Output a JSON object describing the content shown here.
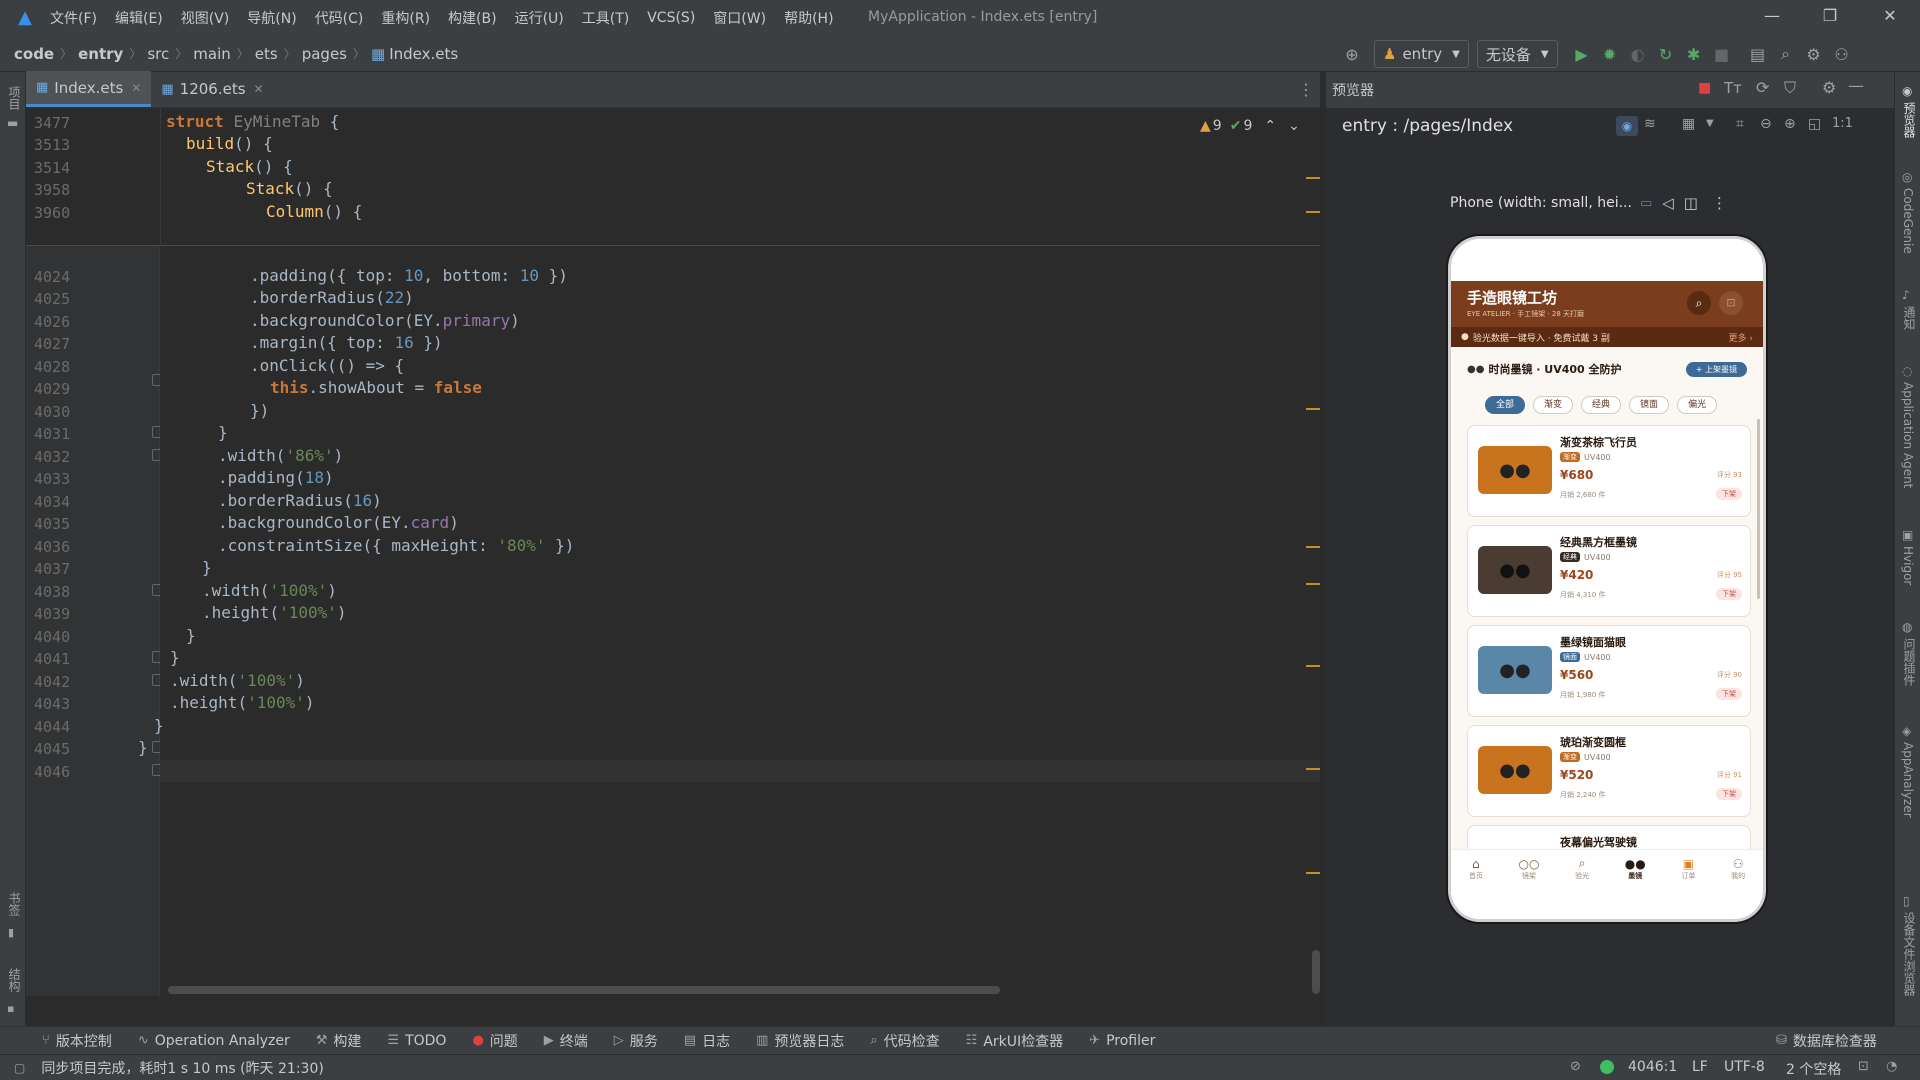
{
  "menubar": {
    "items": [
      "文件(F)",
      "编辑(E)",
      "视图(V)",
      "导航(N)",
      "代码(C)",
      "重构(R)",
      "构建(B)",
      "运行(U)",
      "工具(T)",
      "VCS(S)",
      "窗口(W)",
      "帮助(H)"
    ],
    "title": "MyApplication - Index.ets [entry]"
  },
  "breadcrumb": [
    "code",
    "entry",
    "src",
    "main",
    "ets",
    "pages",
    "Index.ets"
  ],
  "toolbar": {
    "module": "entry",
    "device": "无设备"
  },
  "left_strip": {
    "top": "项目",
    "mid": "书签",
    "bottom": "结构"
  },
  "tabs": [
    "Index.ets",
    "1206.ets"
  ],
  "inspect": {
    "warnings": "9",
    "checks": "9"
  },
  "sticky": [
    {
      "n": "3477"
    },
    {
      "n": "3513"
    },
    {
      "n": "3514"
    },
    {
      "n": "3958"
    },
    {
      "n": "3960"
    }
  ],
  "lines": [
    "4024",
    "4025",
    "4026",
    "4027",
    "4028",
    "4029",
    "4030",
    "4031",
    "4032",
    "4033",
    "4034",
    "4035",
    "4036",
    "4037",
    "4038",
    "4039",
    "4040",
    "4041",
    "4042",
    "4043",
    "4044",
    "4045",
    "4046"
  ],
  "preview": {
    "title": "预览器",
    "path": "entry : /pages/Index",
    "device": "Phone (width: small, hei..."
  },
  "phone": {
    "app_title": "手造眼镜工坊",
    "app_sub": "EYE ATELIER · 手工镜架 · 28 天打磨",
    "ticker": "验光数据一键导入 · 免费试戴 3 副",
    "ticker_more": "更多 ›",
    "section": "时尚墨镜 · UV400 全防护",
    "upload": "+ 上架墨镜",
    "chips": [
      "全部",
      "渐变",
      "经典",
      "镜面",
      "偏光"
    ],
    "products": [
      {
        "name": "渐变茶棕飞行员",
        "tag": "渐变",
        "uv": "UV400",
        "price": "¥680",
        "sold": "月销 2,680 件",
        "score": "评分 93",
        "btn": "下架",
        "color": "#c8741e"
      },
      {
        "name": "经典黑方框墨镜",
        "tag": "经典",
        "uv": "UV400",
        "price": "¥420",
        "sold": "月销 4,310 件",
        "score": "评分 95",
        "btn": "下架",
        "color": "#4a3c32"
      },
      {
        "name": "墨绿镜面猫眼",
        "tag": "镜面",
        "uv": "UV400",
        "price": "¥560",
        "sold": "月销 1,980 件",
        "score": "评分 90",
        "btn": "下架",
        "color": "#5a86a8"
      },
      {
        "name": "琥珀渐变圆框",
        "tag": "渐变",
        "uv": "UV400",
        "price": "¥520",
        "sold": "月销 2,240 件",
        "score": "评分 91",
        "btn": "下架",
        "color": "#c8741e"
      },
      {
        "name": "夜幕偏光驾驶镜"
      }
    ],
    "tabbar": [
      "首页",
      "镜架",
      "验光",
      "墨镜",
      "订单",
      "我的"
    ]
  },
  "right_strip": [
    "预览器",
    "CodeGenie",
    "通知",
    "Application Agent",
    "Hvigor",
    "问题插件",
    "AppAnalyzer",
    "设备文件浏览器"
  ],
  "bottom_tools": [
    "版本控制",
    "Operation Analyzer",
    "构建",
    "TODO",
    "问题",
    "终端",
    "服务",
    "日志",
    "预览器日志",
    "代码检查",
    "ArkUI检查器",
    "Profiler"
  ],
  "bottom_right": "数据库检查器",
  "status": {
    "message": "同步项目完成，耗时1 s 10 ms (昨天 21:30)",
    "position": "4046:1",
    "line_sep": "LF",
    "encoding": "UTF-8",
    "indent": "2 个空格"
  }
}
